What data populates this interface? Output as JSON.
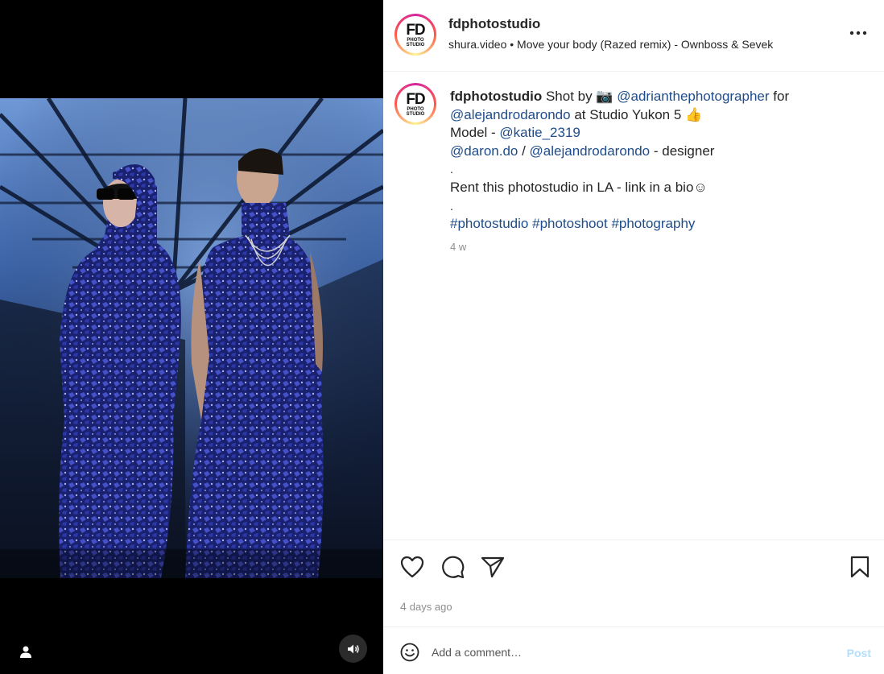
{
  "post": {
    "username": "fdphotostudio",
    "audio": "shura.video • Move your body (Razed remix) - Ownboss & Sevek",
    "avatar_text": "FD",
    "avatar_subtext_1": "PHOTO",
    "avatar_subtext_2": "STUDIO"
  },
  "caption": {
    "username": "fdphotostudio",
    "line1_text_a": " Shot by 📷  ",
    "line1_mention": "@adrianthephotographer",
    "line1_text_b": " for",
    "line2_mention": "@alejandrodarondo",
    "line2_text": " at Studio Yukon 5 👍",
    "line3_text": "Model - ",
    "line3_mention": "@katie_2319",
    "line4_mention_a": "@daron.do",
    "line4_sep": " / ",
    "line4_mention_b": "@alejandrodarondo",
    "line4_text": " - designer",
    "dot1": ".",
    "line5_text": "Rent this photostudio in LA - link in a bio☺",
    "dot2": ".",
    "hashtag1": "#photostudio",
    "hashtag2": "#photoshoot",
    "hashtag3": "#photography",
    "age": "4 w"
  },
  "actions": {
    "timestamp_num": "4",
    "timestamp_text": "days ago"
  },
  "comment": {
    "placeholder": "Add a comment…",
    "post_label": "Post"
  },
  "colors": {
    "link": "#1f4c8a",
    "post_disabled": "#b2dffc",
    "media_bg": "#000000"
  },
  "icons": [
    "user-tag-icon",
    "audio-icon",
    "more-icon",
    "heart-icon",
    "comment-icon",
    "share-icon",
    "bookmark-icon",
    "emoji-icon"
  ]
}
